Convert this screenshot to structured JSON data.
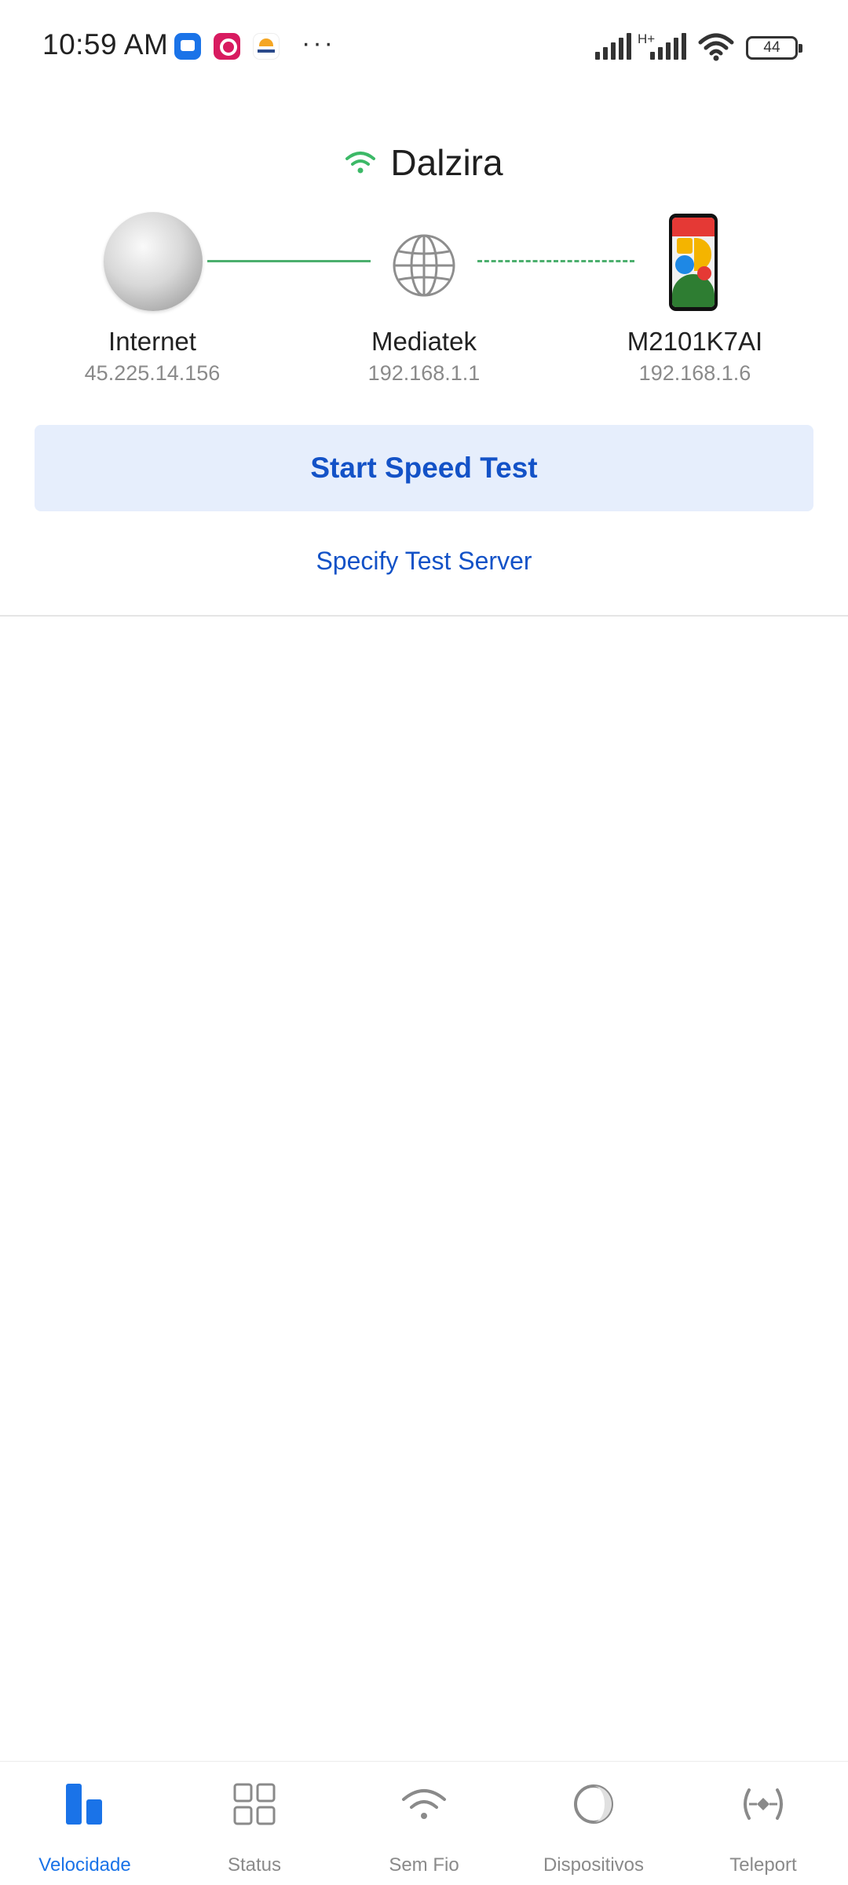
{
  "status_bar": {
    "time": "10:59 AM",
    "more": "···",
    "network_type": "H+",
    "battery": "44",
    "notification_icons": [
      "messages-icon",
      "app-notification-icon",
      "weather-icon"
    ]
  },
  "network": {
    "ssid": "Dalzira",
    "wifi_color": "#3cb967"
  },
  "topology": {
    "internet": {
      "label": "Internet",
      "ip": "45.225.14.156"
    },
    "router": {
      "label": "Mediatek",
      "ip": "192.168.1.1"
    },
    "device": {
      "label": "M2101K7AI",
      "ip": "192.168.1.6"
    },
    "link_color": "#4caf6e"
  },
  "actions": {
    "start_speed_test": "Start Speed Test",
    "specify_server": "Specify Test Server"
  },
  "bottom_nav": {
    "items": [
      {
        "label": "Velocidade",
        "icon": "speed-bars-icon",
        "active": true
      },
      {
        "label": "Status",
        "icon": "grid-icon",
        "active": false
      },
      {
        "label": "Sem Fio",
        "icon": "wifi-icon",
        "active": false
      },
      {
        "label": "Dispositivos",
        "icon": "devices-circle-icon",
        "active": false
      },
      {
        "label": "Teleport",
        "icon": "teleport-icon",
        "active": false
      }
    ],
    "active_color": "#1a73e8",
    "inactive_color": "#8a8a8a"
  }
}
